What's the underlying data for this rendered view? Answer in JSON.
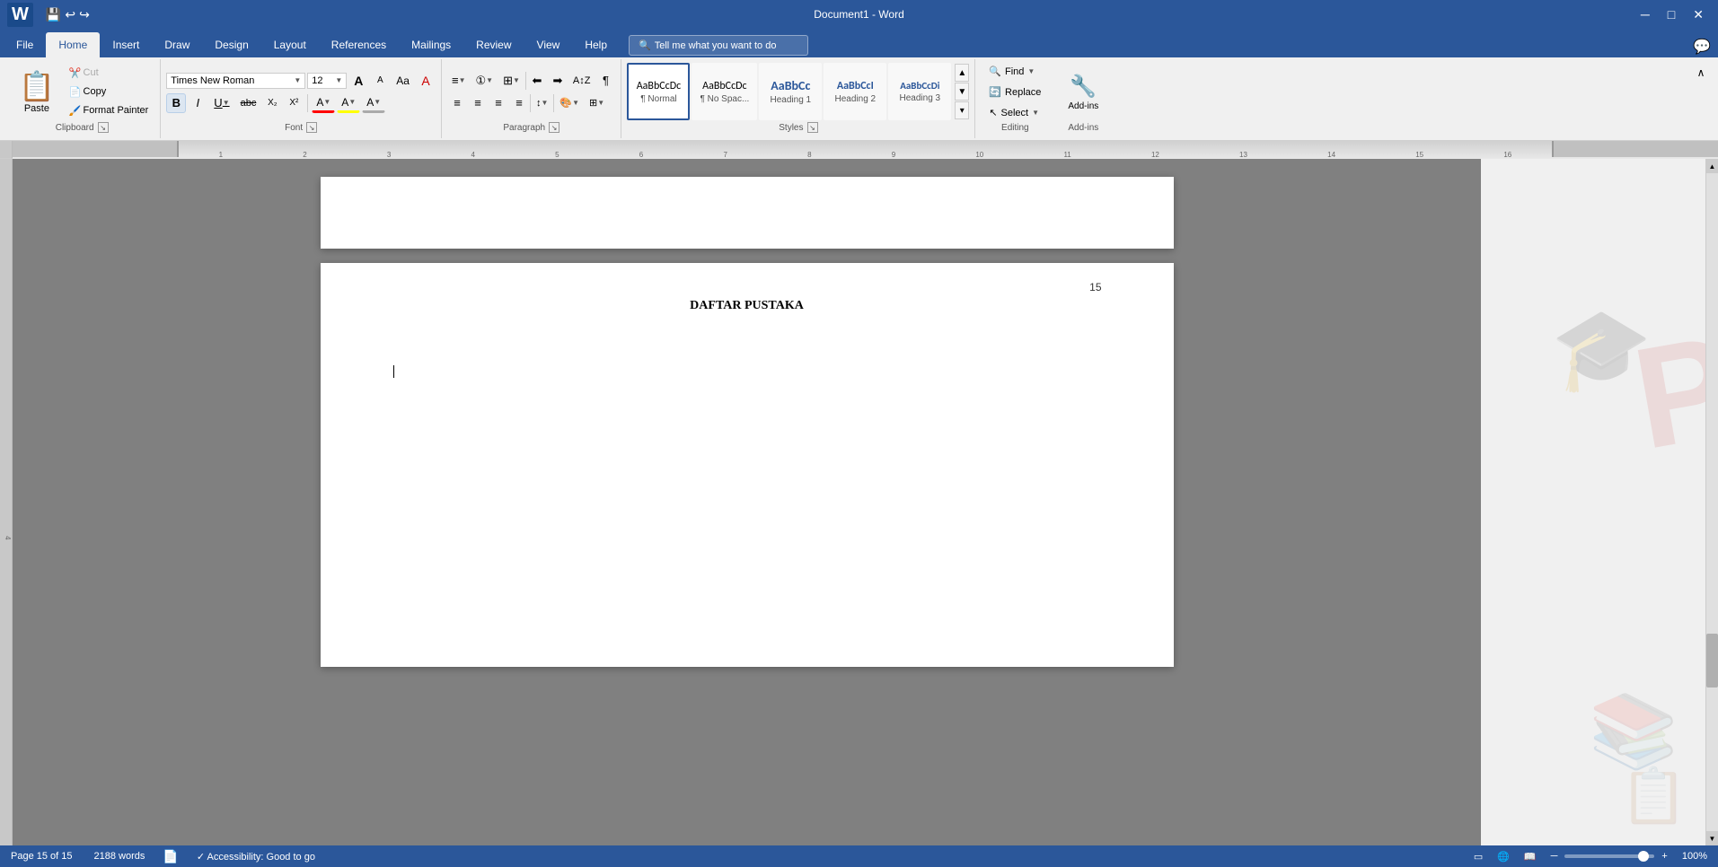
{
  "titlebar": {
    "title": "Document1 - Word",
    "minimize_label": "─",
    "maximize_label": "□",
    "close_label": "✕"
  },
  "ribbon": {
    "tabs": [
      {
        "id": "file",
        "label": "File"
      },
      {
        "id": "home",
        "label": "Home",
        "active": true
      },
      {
        "id": "insert",
        "label": "Insert"
      },
      {
        "id": "draw",
        "label": "Draw"
      },
      {
        "id": "design",
        "label": "Design"
      },
      {
        "id": "layout",
        "label": "Layout"
      },
      {
        "id": "references",
        "label": "References"
      },
      {
        "id": "mailings",
        "label": "Mailings"
      },
      {
        "id": "review",
        "label": "Review"
      },
      {
        "id": "view",
        "label": "View"
      },
      {
        "id": "help",
        "label": "Help"
      }
    ],
    "tellme": "Tell me what you want to do",
    "clipboard": {
      "paste_label": "Paste",
      "cut_label": "Cut",
      "copy_label": "Copy",
      "format_painter_label": "Format Painter",
      "group_label": "Clipboard"
    },
    "font": {
      "font_name": "Times New Roman",
      "font_size": "12",
      "grow_label": "A",
      "shrink_label": "A",
      "case_label": "Aa",
      "clear_label": "A",
      "bold_label": "B",
      "italic_label": "I",
      "underline_label": "U",
      "strikethrough_label": "abc",
      "subscript_label": "X₂",
      "superscript_label": "X²",
      "font_color_label": "A",
      "highlight_label": "A",
      "group_label": "Font"
    },
    "paragraph": {
      "group_label": "Paragraph"
    },
    "styles": {
      "normal_label": "¶ Normal",
      "normal_tag": "Normal",
      "nospace_tag": "No Spac...",
      "h1_tag": "Heading 1",
      "h2_tag": "Heading 2",
      "h3_tag": "Heading 3",
      "group_label": "Styles"
    },
    "editing": {
      "find_label": "Find",
      "replace_label": "Replace",
      "select_label": "Select",
      "group_label": "Editing"
    },
    "addins": {
      "group_label": "Add-ins",
      "addins_label": "Add-ins"
    }
  },
  "document": {
    "page_number": "15",
    "heading": "DAFTAR PUSTAKA"
  },
  "statusbar": {
    "page_info": "Page 15 of 15",
    "word_count": "2188 words",
    "accessibility": "Accessibility: Good to go",
    "zoom_level": "100%",
    "zoom_minus": "─",
    "zoom_plus": "+"
  }
}
